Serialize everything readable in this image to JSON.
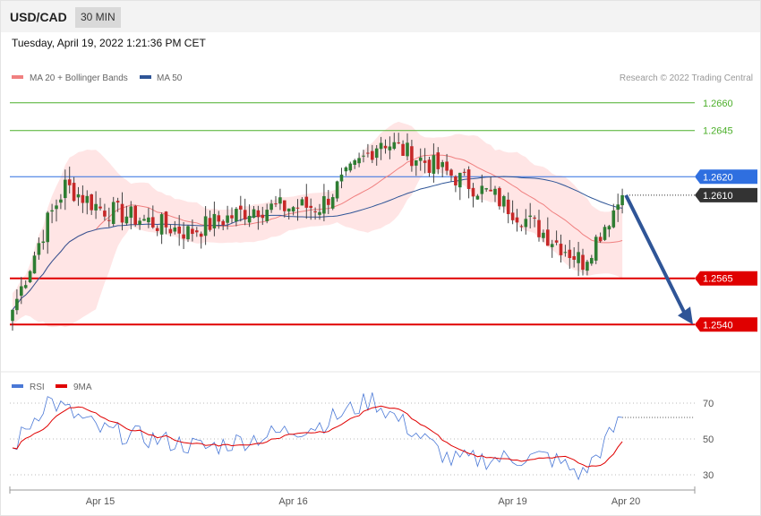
{
  "header": {
    "symbol": "USD/CAD",
    "timeframe": "30 MIN"
  },
  "datetime": "Tuesday, April 19, 2022 1:21:36 PM CET",
  "legend": {
    "ma20": "MA 20 + Bollinger Bands",
    "ma50": "MA 50",
    "rsi": "RSI",
    "ma9": "9MA"
  },
  "copyright": "Research © 2022 Trading Central",
  "colors": {
    "bull": "#2e7d32",
    "bear": "#c62828",
    "ma20": "#f08080",
    "ma50": "#2f5597",
    "band": "#ffe1e1",
    "resistance_green": "#4caf2a",
    "blue_level": "#2f6fe0",
    "red_level": "#e00000",
    "current": "#333333",
    "rsi": "#4a78d6",
    "ma9": "#e00000"
  },
  "chart_data": [
    {
      "type": "candlestick",
      "ylim": [
        1.2513,
        1.2672
      ],
      "levels": [
        {
          "label": "1.2660",
          "value": 1.266,
          "kind": "resistance"
        },
        {
          "label": "1.2645",
          "value": 1.2645,
          "kind": "resistance"
        },
        {
          "label": "1.2620",
          "value": 1.262,
          "kind": "pivot"
        },
        {
          "label": "1.2610",
          "value": 1.261,
          "kind": "current"
        },
        {
          "label": "1.2565",
          "value": 1.2565,
          "kind": "support"
        },
        {
          "label": "1.2540",
          "value": 1.254,
          "kind": "support"
        }
      ],
      "x_ticks": [
        {
          "label": "Apr 15",
          "index": 20
        },
        {
          "label": "Apr 16",
          "index": 64
        },
        {
          "label": "Apr 19",
          "index": 114
        },
        {
          "label": "Apr 20",
          "index": 139
        }
      ],
      "key_closes": [
        {
          "index": 0,
          "close": 1.2548
        },
        {
          "index": 8,
          "close": 1.2596
        },
        {
          "index": 12,
          "close": 1.2615
        },
        {
          "index": 20,
          "close": 1.2603
        },
        {
          "index": 40,
          "close": 1.259
        },
        {
          "index": 55,
          "close": 1.2603
        },
        {
          "index": 70,
          "close": 1.2604
        },
        {
          "index": 84,
          "close": 1.264
        },
        {
          "index": 95,
          "close": 1.2627
        },
        {
          "index": 110,
          "close": 1.2609
        },
        {
          "index": 130,
          "close": 1.2574
        },
        {
          "index": 139,
          "close": 1.261
        }
      ],
      "forecast_target": 1.254
    },
    {
      "type": "line",
      "name": "RSI",
      "ylim": [
        20,
        80
      ],
      "y_ticks": [
        30,
        50,
        70
      ],
      "key_values": [
        {
          "index": 0,
          "value": 45
        },
        {
          "index": 8,
          "value": 72
        },
        {
          "index": 20,
          "value": 55
        },
        {
          "index": 44,
          "value": 45
        },
        {
          "index": 70,
          "value": 58
        },
        {
          "index": 82,
          "value": 72
        },
        {
          "index": 100,
          "value": 38
        },
        {
          "index": 122,
          "value": 40
        },
        {
          "index": 130,
          "value": 30
        },
        {
          "index": 139,
          "value": 62
        }
      ]
    }
  ]
}
